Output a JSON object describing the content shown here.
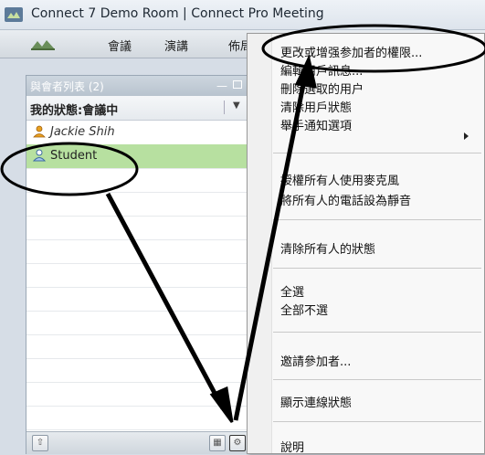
{
  "window": {
    "title": "Connect 7 Demo Room | Connect Pro Meeting",
    "icon": "connect-app-icon"
  },
  "menubar": {
    "logo": "adobe-connect-logo",
    "items": [
      "會議",
      "演講",
      "佈局"
    ]
  },
  "attendee_pod": {
    "title": "與會者列表 (2)",
    "status_label": "我的狀態:會議中",
    "attendees": [
      {
        "name": "Jackie Shih",
        "role": "host",
        "icon": "host-user-icon"
      },
      {
        "name": "Student",
        "role": "participant",
        "icon": "participant-user-icon",
        "selected": true
      }
    ],
    "footer_buttons": [
      "promote-icon",
      "grid-view-icon",
      "pod-options-icon"
    ]
  },
  "context_menu": {
    "items": [
      {
        "label": "更改或增强参加者的權限..."
      },
      {
        "label": "編輯用戶訊息..."
      },
      {
        "label": "刪除選取的用户"
      },
      {
        "label": "清除用戶狀態"
      },
      {
        "label": "舉手通知選項",
        "submenu": true
      },
      {
        "label": "授權所有人使用麥克風"
      },
      {
        "label": "將所有人的電話設為靜音"
      },
      {
        "label": "清除所有人的狀態"
      },
      {
        "label": "全選"
      },
      {
        "label": "全部不選"
      },
      {
        "label": "邀請參加者..."
      },
      {
        "label": "顯示連線狀態"
      },
      {
        "label": "說明"
      }
    ]
  },
  "right_edge_text": "請",
  "colors": {
    "selected_row": "#b7e0a0",
    "annotation": "#000000"
  }
}
